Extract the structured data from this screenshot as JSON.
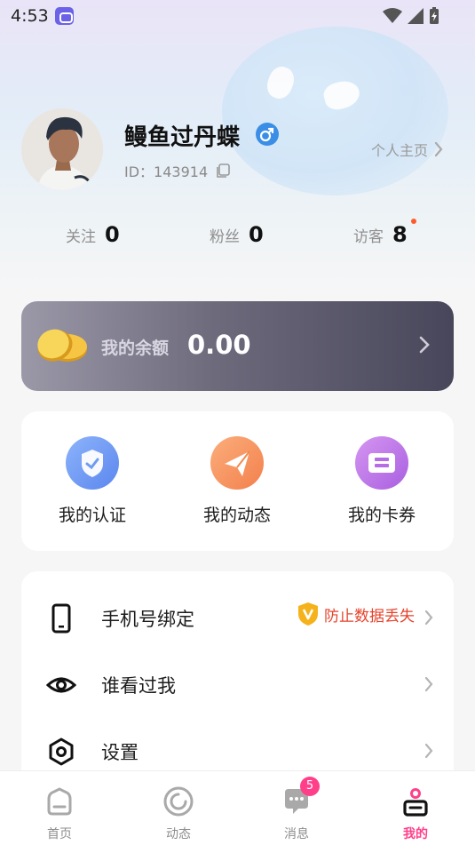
{
  "status_bar": {
    "time": "4:53"
  },
  "profile": {
    "nickname": "鳗鱼过丹蝶",
    "id_label": "ID：143914",
    "homepage_link": "个人主页",
    "gender_icon": "male-icon"
  },
  "stats": [
    {
      "label": "关注",
      "value": "0"
    },
    {
      "label": "粉丝",
      "value": "0"
    },
    {
      "label": "访客",
      "value": "8"
    }
  ],
  "balance": {
    "label": "我的余额",
    "amount": "0.00"
  },
  "quick_actions": [
    {
      "label": "我的认证",
      "icon": "shield-check-icon",
      "color": "#6f9bf2"
    },
    {
      "label": "我的动态",
      "icon": "paper-plane-icon",
      "color": "#f7925c"
    },
    {
      "label": "我的卡券",
      "icon": "ticket-icon",
      "color": "#c178ea"
    }
  ],
  "menu": [
    {
      "label": "手机号绑定",
      "icon": "phone-icon",
      "tip": "防止数据丢失"
    },
    {
      "label": "谁看过我",
      "icon": "eye-icon"
    },
    {
      "label": "设置",
      "icon": "hexagon-settings-icon"
    }
  ],
  "tabbar": {
    "items": [
      {
        "label": "首页",
        "icon": "home-icon"
      },
      {
        "label": "动态",
        "icon": "circle-feed-icon"
      },
      {
        "label": "消息",
        "icon": "message-icon",
        "badge": "5"
      },
      {
        "label": "我的",
        "icon": "profile-icon",
        "active": true
      }
    ],
    "active_color": "#ff3f8a"
  }
}
